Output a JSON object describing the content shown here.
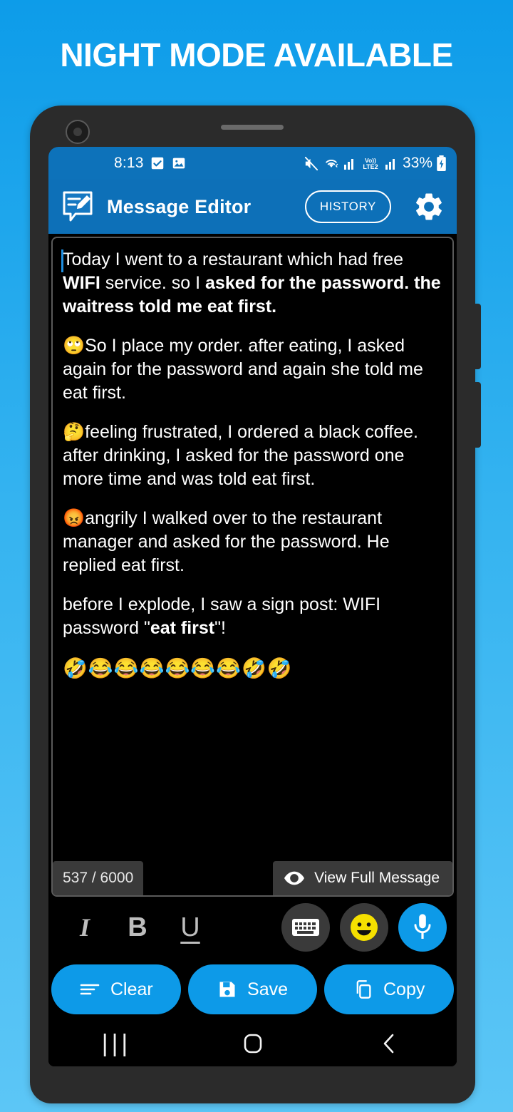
{
  "headline": "NIGHT MODE AVAILABLE",
  "theme": {
    "bg_top": "#0d9ce9",
    "bg_bottom": "#5cc6f6",
    "accent": "#0d9ae8",
    "appbar": "#0d70b8",
    "statusbar": "#0d72ba",
    "screen_bg": "#000000",
    "chip_bg": "#3a3a3a"
  },
  "statusbar": {
    "time": "8:13",
    "left_icons": [
      "checkbox-icon",
      "image-icon"
    ],
    "right_icons": [
      "mute-icon",
      "wifi-icon",
      "signal-icon",
      "volte2-icon",
      "signal2-icon"
    ],
    "volte_label": "Vo))\nLTE2",
    "battery_percent": "33%",
    "battery_state": "charging"
  },
  "appbar": {
    "logo_icon": "message-edit-icon",
    "title": "Message Editor",
    "history_label": "HISTORY",
    "settings_icon": "gear-icon"
  },
  "editor": {
    "paragraphs": [
      {
        "parts": [
          {
            "text": "Today I went to a restaurant which had free ",
            "bold": false
          },
          {
            "text": "WIFI",
            "bold": true
          },
          {
            "text": " service. so I ",
            "bold": false
          },
          {
            "text": "asked for the password. the waitress told me eat first.",
            "bold": true
          }
        ]
      },
      {
        "parts": [
          {
            "text": "🙄So I place my order. after eating, I asked again for the password and again she told me eat first.",
            "bold": false
          }
        ]
      },
      {
        "parts": [
          {
            "text": "🤔feeling frustrated,  I ordered a black coffee. after drinking, I asked for the password one more time and was told eat first.",
            "bold": false
          }
        ]
      },
      {
        "parts": [
          {
            "text": "😡angrily I walked over to the restaurant manager and asked for the password. He replied eat first.",
            "bold": false
          }
        ]
      },
      {
        "parts": [
          {
            "text": "before I explode, I saw a sign post: WIFI password \"",
            "bold": false
          },
          {
            "text": "eat first",
            "bold": true
          },
          {
            "text": "\"!",
            "bold": false
          }
        ]
      }
    ],
    "emoji_row": "🤣😂😂😂😂😂😂🤣🤣",
    "char_count": "537 / 6000",
    "view_full_label": "View Full Message",
    "view_full_icon": "eye-icon",
    "caret_visible": true
  },
  "format_toolbar": {
    "italic_label": "I",
    "bold_label": "B",
    "underline_label": "U",
    "keyboard_icon": "keyboard-icon",
    "emoji_icon": "emoji-smiley-icon",
    "mic_icon": "microphone-icon"
  },
  "actions": [
    {
      "label": "Clear",
      "icon": "clear-lines-icon"
    },
    {
      "label": "Save",
      "icon": "floppy-save-icon"
    },
    {
      "label": "Copy",
      "icon": "copy-icon"
    }
  ],
  "navbar": {
    "recents_label": "|||",
    "home_icon": "home-square-icon",
    "back_icon": "back-chevron-icon"
  }
}
